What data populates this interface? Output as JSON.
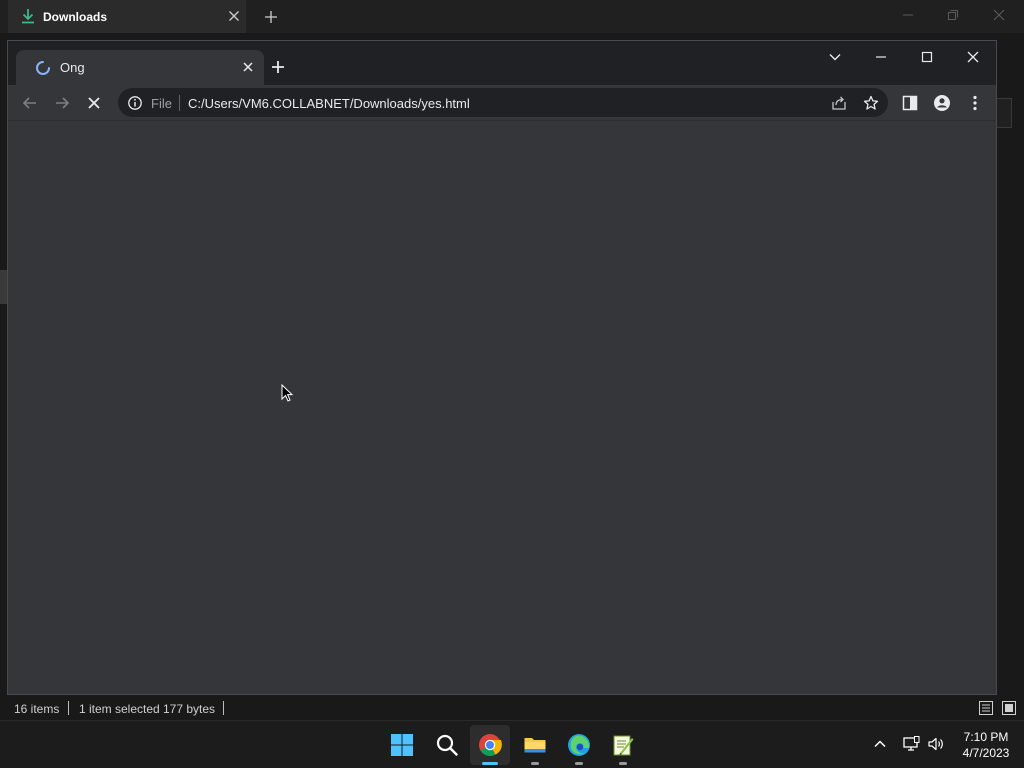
{
  "explorer": {
    "tab_title": "Downloads",
    "status": {
      "items_count": "16 items",
      "selection": "1 item selected",
      "size": "177 bytes"
    }
  },
  "chrome": {
    "tab_title": "Ong",
    "address": {
      "scheme_label": "File",
      "url": "C:/Users/VM6.COLLABNET/Downloads/yes.html"
    }
  },
  "taskbar": {
    "apps": [
      "start",
      "search",
      "chrome",
      "file-explorer",
      "edge",
      "notepad-plus-plus"
    ],
    "active_app": "chrome",
    "clock": {
      "time": "7:10 PM",
      "date": "4/7/2023"
    }
  },
  "colors": {
    "chrome_frame": "#202124",
    "chrome_content": "#35363a",
    "accent": "#4cc2ff",
    "spinner": "#8ab4f8",
    "download_green": "#3fb68b"
  }
}
